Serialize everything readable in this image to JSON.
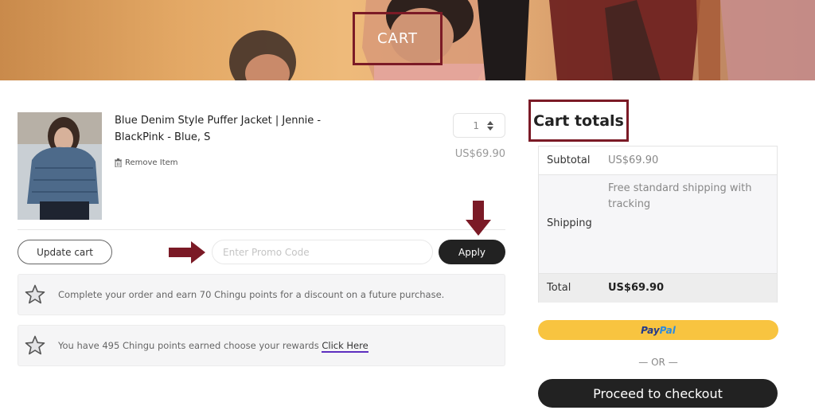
{
  "hero": {
    "title": "CART"
  },
  "cart_item": {
    "name": "Blue Denim Style Puffer Jacket | Jennie - BlackPink - Blue, S",
    "remove_label": "Remove Item",
    "quantity": "1",
    "price": "US$69.90",
    "icons": {
      "remove": "trash-icon",
      "quantity": "stepper-arrows-icon"
    }
  },
  "actions": {
    "update_cart_label": "Update cart",
    "promo_placeholder": "Enter Promo Code",
    "apply_label": "Apply"
  },
  "notices": [
    {
      "text": "Complete your order and earn 70 Chingu points for a discount on a future purchase.",
      "icon": "star-icon"
    },
    {
      "text": "You have 495 Chingu points earned choose your rewards ",
      "link": "Click Here",
      "icon": "star-icon"
    }
  ],
  "totals": {
    "heading": "Cart totals",
    "subtotal_label": "Subtotal",
    "subtotal_value": "US$69.90",
    "shipping_label": "Shipping",
    "shipping_value": "Free standard shipping with tracking",
    "total_label": "Total",
    "total_value": "US$69.90"
  },
  "checkout": {
    "paypal_part1": "Pay",
    "paypal_part2": "Pal",
    "or_label": "— OR —",
    "proceed_label": "Proceed to checkout"
  },
  "colors": {
    "annotation": "#7b1a26",
    "primary_button": "#222222",
    "paypal": "#f8c440",
    "link_underline": "#5d2fbf"
  }
}
